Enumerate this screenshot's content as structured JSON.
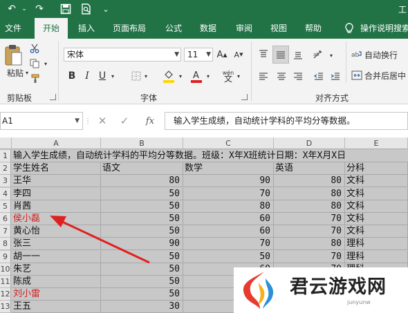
{
  "window": {
    "title": "工"
  },
  "quick_access": {
    "undo": "↶",
    "redo": "↷",
    "save": "save-icon",
    "preview": "print-preview-icon",
    "customize": "⌄"
  },
  "ribbon_tabs": [
    "文件",
    "开始",
    "插入",
    "页面布局",
    "公式",
    "数据",
    "审阅",
    "视图",
    "帮助"
  ],
  "active_tab": "开始",
  "tell_me": "操作说明搜索",
  "clipboard": {
    "paste_label": "粘贴",
    "group_label": "剪贴板"
  },
  "font": {
    "name": "宋体",
    "size": "11",
    "group_label": "字体",
    "bold": "B",
    "italic": "I",
    "underline": "U",
    "grow": "A",
    "shrink": "A",
    "wen": "wén",
    "font_color_accent": "#e02020",
    "fill_color_accent": "#ffd700"
  },
  "alignment": {
    "wrap_label": "自动换行",
    "merge_label": "合并后居中",
    "group_label": "对齐方式"
  },
  "formula_bar": {
    "name_box": "A1",
    "fx": "fx",
    "formula": "输入学生成绩，自动统计学科的平均分等数据。"
  },
  "sheet": {
    "columns": [
      "A",
      "B",
      "C",
      "D",
      "E"
    ],
    "rows": [
      "1",
      "2",
      "3",
      "4",
      "5",
      "6",
      "7",
      "8",
      "9",
      "10",
      "11",
      "12",
      "13"
    ],
    "title_row": "输入学生成绩，自动统计学科的平均分等数据。班级：X年X班统计日期：X年X月X日",
    "headers": [
      "学生姓名",
      "语文",
      "数学",
      "英语",
      "分科"
    ],
    "data": [
      [
        "王华",
        "80",
        "90",
        "80",
        "文科"
      ],
      [
        "李四",
        "50",
        "70",
        "80",
        "文科"
      ],
      [
        "肖茜",
        "50",
        "80",
        "80",
        "文科"
      ],
      [
        "侯小磊",
        "50",
        "60",
        "70",
        "文科"
      ],
      [
        "黄心怡",
        "50",
        "60",
        "70",
        "文科"
      ],
      [
        "张三",
        "90",
        "70",
        "80",
        "理科"
      ],
      [
        "胡一一",
        "50",
        "50",
        "70",
        "理科"
      ],
      [
        "朱艺",
        "50",
        "60",
        "70",
        "理科"
      ],
      [
        "陈成",
        "50",
        "",
        "",
        ""
      ],
      [
        "刘小雷",
        "50",
        "",
        "",
        ""
      ],
      [
        "王五",
        "30",
        "",
        "",
        ""
      ]
    ],
    "red_names": [
      "侯小磊",
      "刘小雷"
    ]
  },
  "watermark": {
    "text": "君云游戏网",
    "sub": "junyunw"
  }
}
